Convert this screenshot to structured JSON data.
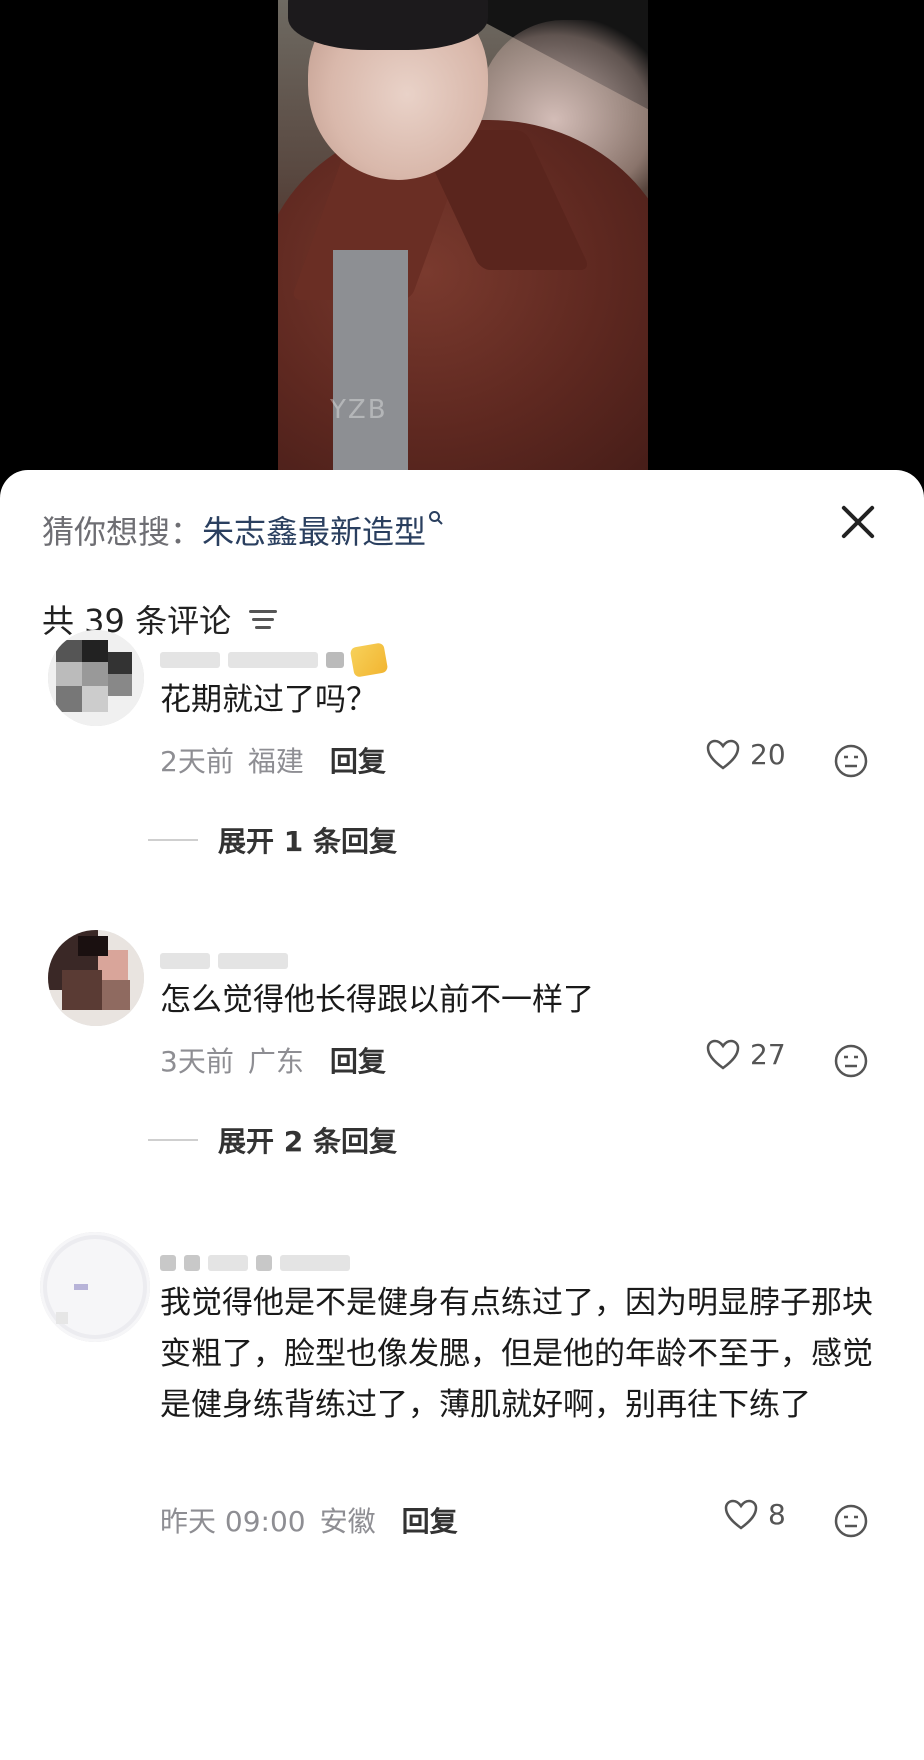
{
  "search_suggestion": {
    "prefix": "猜你想搜：",
    "term": "朱志鑫最新造型",
    "icon": "search-icon"
  },
  "header": {
    "comment_count": "共 39 条评论",
    "sort_icon": "sort-icon",
    "close_icon": "close-icon"
  },
  "video": {
    "watermark": "YZB"
  },
  "comments": [
    {
      "text": "花期就过了吗？",
      "time": "2天前",
      "location": "福建",
      "reply_label": "回复",
      "likes": "20",
      "expand_label": "展开 1 条回复"
    },
    {
      "text": "怎么觉得他长得跟以前不一样了",
      "time": "3天前",
      "location": "广东",
      "reply_label": "回复",
      "likes": "27",
      "expand_label": "展开 2 条回复"
    },
    {
      "text": "我觉得他是不是健身有点练过了，因为明显脖子那块变粗了，脸型也像发腮，但是他的年龄不至于，感觉是健身练背练过了，薄肌就好啊，别再往下练了",
      "time": "昨天 09:00",
      "location": "安徽",
      "reply_label": "回复",
      "likes": "8"
    }
  ],
  "colors": {
    "accent_link": "#2a3f5f",
    "meta_gray": "#8e8e93",
    "badge_gold": "#f2b531"
  }
}
